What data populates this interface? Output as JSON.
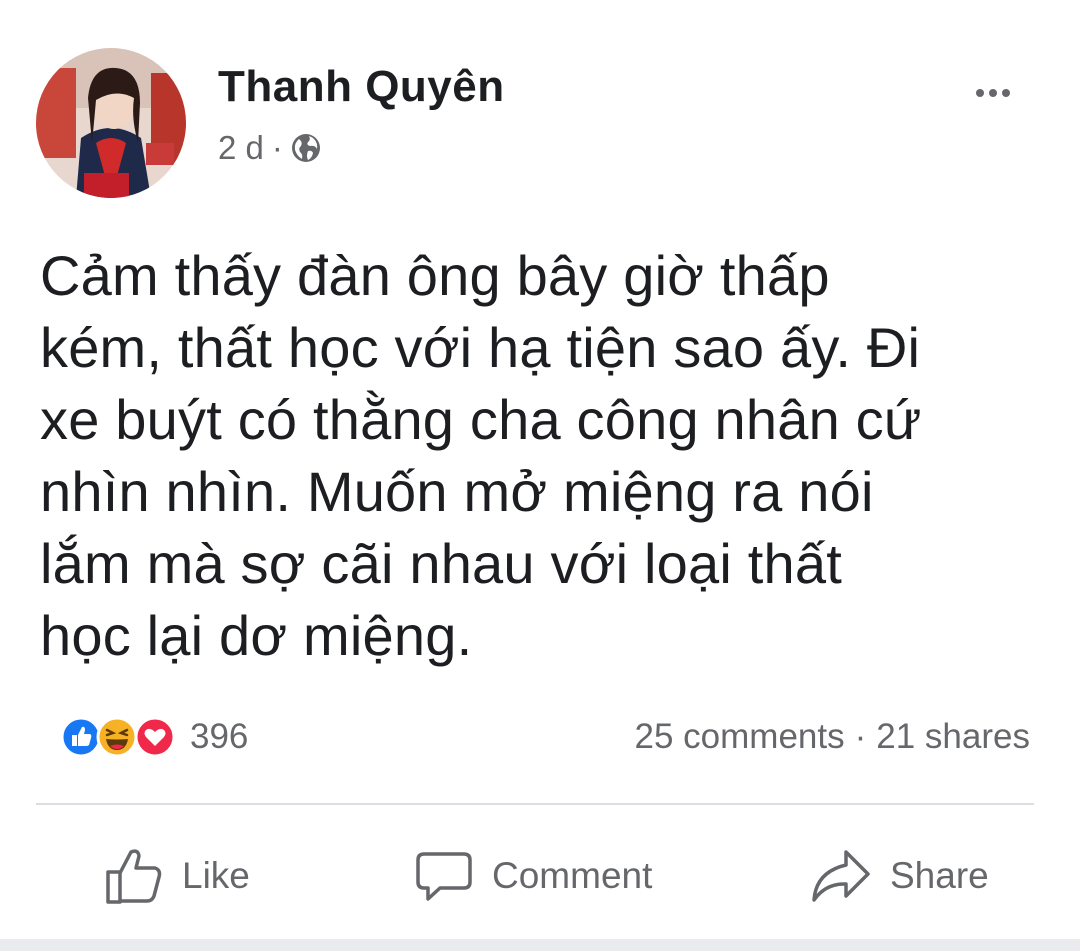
{
  "post": {
    "author": "Thanh Quyên",
    "time": "2 d",
    "separator": "·",
    "privacy_icon": "globe-icon",
    "more_icon": "more-horizontal-icon",
    "text_lines": [
      "Cảm thấy đàn ông bây giờ thấp",
      "kém, thất học với hạ tiện sao ấy. Đi",
      "xe buýt có thằng cha công nhân cứ",
      "nhìn nhìn. Muốn mở miệng ra nói",
      "lắm mà sợ cãi nhau với loại thất",
      "học lại dơ miệng."
    ]
  },
  "stats": {
    "reaction_icons": [
      "like-reaction-icon",
      "haha-reaction-icon",
      "love-reaction-icon"
    ],
    "reaction_count": "396",
    "comments": "25 comments",
    "dot": "·",
    "shares": "21 shares"
  },
  "actions": {
    "like_label": "Like",
    "comment_label": "Comment",
    "share_label": "Share"
  },
  "colors": {
    "text_primary": "#1c1e21",
    "text_secondary": "#65676b",
    "like_blue": "#1877f2",
    "haha_yellow": "#f7b125",
    "love_red": "#f02849",
    "divider": "#dadde1"
  }
}
